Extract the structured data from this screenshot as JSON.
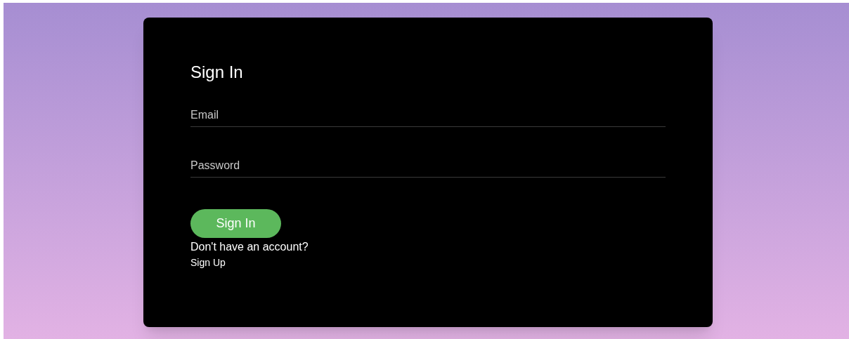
{
  "title": "Sign In",
  "fields": [
    {
      "placeholder": "Email"
    },
    {
      "placeholder": "Password"
    }
  ],
  "submit": "Sign In",
  "prompt": "Don't have an account?",
  "link": "Sign Up"
}
